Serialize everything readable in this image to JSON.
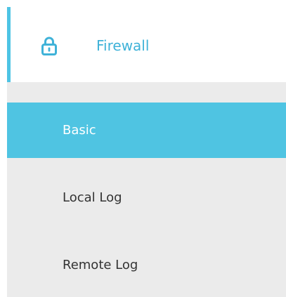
{
  "nav": {
    "section": {
      "title": "Firewall",
      "icon": "lock-icon",
      "accent_color": "#4ec4e4"
    },
    "items": [
      {
        "label": "Basic",
        "active": true
      },
      {
        "label": "Local Log",
        "active": false
      },
      {
        "label": "Remote Log",
        "active": false
      }
    ]
  },
  "colors": {
    "active_background": "#4fc4e2",
    "panel_background": "#ebebeb",
    "title_color": "#3fb2d8"
  }
}
